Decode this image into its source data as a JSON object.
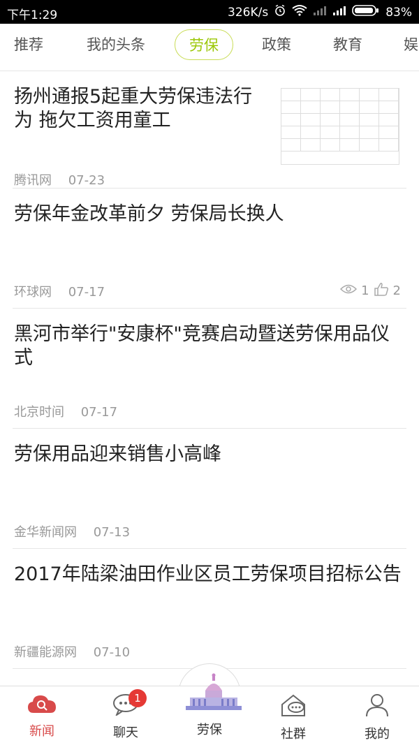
{
  "status_bar": {
    "time": "下午1:29",
    "speed": "326K/s",
    "battery": "83%"
  },
  "tabs": [
    {
      "label": "推荐"
    },
    {
      "label": "我的头条"
    },
    {
      "label": "劳保"
    },
    {
      "label": "政策"
    },
    {
      "label": "教育"
    },
    {
      "label": "娱"
    }
  ],
  "articles": [
    {
      "title": "扬州通报5起重大劳保违法行为 拖欠工资用童工",
      "source": "腾讯网",
      "date": "07-23"
    },
    {
      "title": "劳保年金改革前夕 劳保局长换人",
      "source": "环球网",
      "date": "07-17",
      "views": "1",
      "likes": "2"
    },
    {
      "title": "黑河市举行\"安康杯\"竞赛启动暨送劳保用品仪式",
      "source": "北京时间",
      "date": "07-17"
    },
    {
      "title": "劳保用品迎来销售小高峰",
      "source": "金华新闻网",
      "date": "07-13"
    },
    {
      "title": "2017年陆梁油田作业区员工劳保项目招标公告",
      "source": "新疆能源网",
      "date": "07-10"
    }
  ],
  "bottom_nav": {
    "news": "新闻",
    "chat": "聊天",
    "chat_badge": "1",
    "labor": "劳保",
    "community": "社群",
    "mine": "我的"
  },
  "colors": {
    "accent": "#9cc80a",
    "news_red": "#d84a4a"
  }
}
